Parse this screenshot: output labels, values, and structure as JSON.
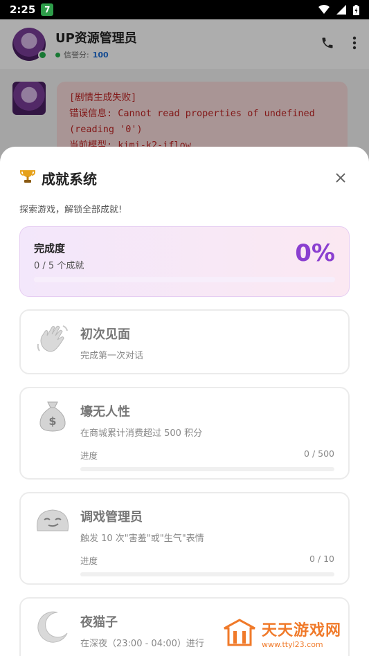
{
  "status_bar": {
    "time": "2:25",
    "app_badge": "7"
  },
  "chat_header": {
    "title": "UP资源管理员",
    "score_label": "信誉分:",
    "score_value": "100"
  },
  "chat_message": {
    "lines": [
      "[剧情生成失败]",
      "错误信息: Cannot read properties of undefined",
      "(reading '0')",
      "当前模型: kimi-k2-iflow"
    ]
  },
  "sheet": {
    "title": "成就系统",
    "subtitle": "探索游戏，解锁全部成就!",
    "progress": {
      "label": "完成度",
      "count_text": "0 / 5 个成就",
      "percent_text": "0%",
      "fraction": 0
    },
    "achievements": [
      {
        "icon": "waving-hand-icon",
        "title": "初次见面",
        "desc": "完成第一次对话"
      },
      {
        "icon": "money-bag-icon",
        "title": "壕无人性",
        "desc": "在商城累计消费超过 500 积分",
        "progress_label": "进度",
        "progress_text": "0 / 500",
        "fraction": 0
      },
      {
        "icon": "smirk-face-icon",
        "title": "调戏管理员",
        "desc": "触发 10 次\"害羞\"或\"生气\"表情",
        "progress_label": "进度",
        "progress_text": "0 / 10",
        "fraction": 0
      },
      {
        "icon": "moon-icon",
        "title": "夜猫子",
        "desc": "在深夜（23:00 - 04:00）进行"
      }
    ]
  },
  "watermark": {
    "brand": "天天游戏网",
    "url": "www.ttyl23.com"
  },
  "colors": {
    "accent": "#8a3fd0",
    "error_text": "#c02525",
    "online": "#22b14c"
  }
}
